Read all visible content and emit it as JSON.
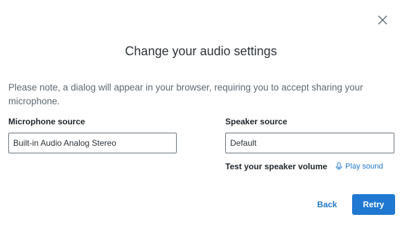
{
  "dialog": {
    "title": "Change your audio settings",
    "note": "Please note, a dialog will appear in your browser, requiring you to accept sharing your microphone.",
    "close_icon": "close-icon"
  },
  "microphone": {
    "label": "Microphone source",
    "value": "Built-in Audio Analog Stereo"
  },
  "speaker": {
    "label": "Speaker source",
    "value": "Default",
    "test_label": "Test your speaker volume",
    "play_icon": "microphone-icon",
    "play_label": "Play sound"
  },
  "actions": {
    "back_label": "Back",
    "retry_label": "Retry"
  },
  "colors": {
    "accent": "#1f78d1",
    "link": "#1f78c9",
    "text": "#2d3338"
  }
}
